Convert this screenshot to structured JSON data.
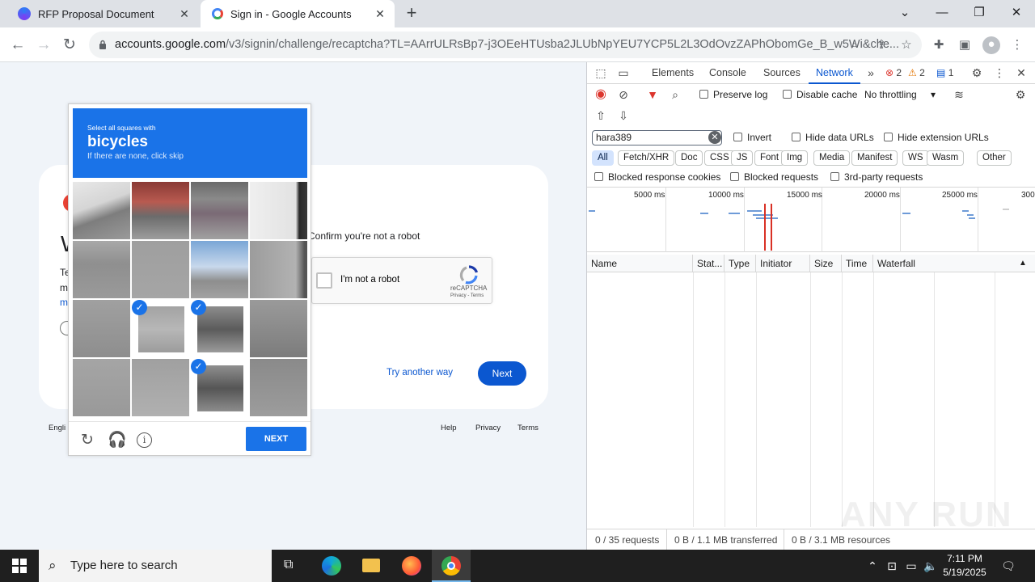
{
  "browser": {
    "tabs": [
      {
        "title": "RFP Proposal Document",
        "active": false
      },
      {
        "title": "Sign in - Google Accounts",
        "active": true
      }
    ],
    "url_host": "accounts.google.com",
    "url_path": "/v3/signin/challenge/recaptcha?TL=AArrULRsBp7-j3OEeHTUsba2JLUbNpYEU7YCP5L2L3OdOvzZAPhObomGe_B_w5Wi&che..."
  },
  "page": {
    "confirm_text": "Confirm you're not a robot",
    "recaptcha": {
      "checkbox_label": "I'm not a robot",
      "brand": "reCAPTCHA",
      "links": "Privacy - Terms"
    },
    "try_another": "Try another way",
    "next": "Next",
    "footer": {
      "lang": "Engli",
      "help": "Help",
      "privacy": "Privacy",
      "terms": "Terms"
    },
    "fragments": {
      "w": "W",
      "te": "Te",
      "m1": "m",
      "m2": "m"
    }
  },
  "captcha": {
    "instruction_small": "Select all squares with",
    "target": "bicycles",
    "hint": "If there are none, click skip",
    "next_button": "NEXT",
    "selected_tiles": [
      9,
      10,
      14
    ]
  },
  "devtools": {
    "tabs": [
      "Elements",
      "Console",
      "Sources",
      "Network"
    ],
    "active_tab": "Network",
    "errors": "2",
    "warnings": "2",
    "messages": "1",
    "preserve_log": "Preserve log",
    "disable_cache": "Disable cache",
    "throttling": "No throttling",
    "filter_value": "hara389",
    "invert": "Invert",
    "hide_data_urls": "Hide data URLs",
    "hide_extension_urls": "Hide extension URLs",
    "type_filters": [
      "All",
      "Fetch/XHR",
      "Doc",
      "CSS",
      "JS",
      "Font",
      "Img",
      "Media",
      "Manifest",
      "WS",
      "Wasm",
      "Other"
    ],
    "blocked_response_cookies": "Blocked response cookies",
    "blocked_requests": "Blocked requests",
    "third_party_requests": "3rd-party requests",
    "timeline_ticks": [
      "5000 ms",
      "10000 ms",
      "15000 ms",
      "20000 ms",
      "25000 ms",
      "300"
    ],
    "columns": [
      "Name",
      "Stat...",
      "Type",
      "Initiator",
      "Size",
      "Time",
      "Waterfall"
    ],
    "status": {
      "requests": "0 / 35 requests",
      "transferred": "0 B / 1.1 MB transferred",
      "resources": "0 B / 3.1 MB resources"
    },
    "watermark": "ANY RUN"
  },
  "taskbar": {
    "search_placeholder": "Type here to search",
    "time": "7:11 PM",
    "date": "5/19/2025"
  }
}
